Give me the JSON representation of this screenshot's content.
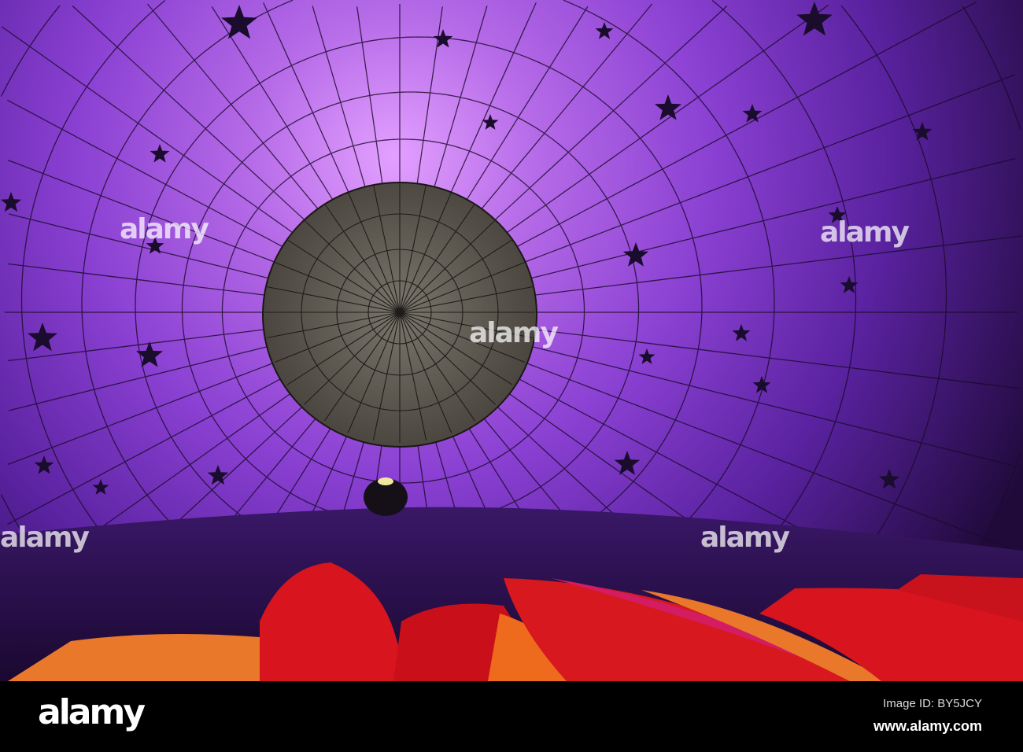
{
  "photo": {
    "subject": "Inside of a purple hot air balloon envelope with stars",
    "colors": {
      "purple_light": "#c77cf0",
      "purple": "#8a3fd0",
      "purple_dark": "#2a0f4a",
      "parachute": "#6e6a60",
      "red": "#d8141e",
      "orange": "#e9561a",
      "pink": "#d01f5c"
    }
  },
  "watermark": {
    "text": "alamy"
  },
  "footer": {
    "logo": "alamy",
    "image_id": "Image ID: BY5JCY",
    "url": "www.alamy.com"
  }
}
